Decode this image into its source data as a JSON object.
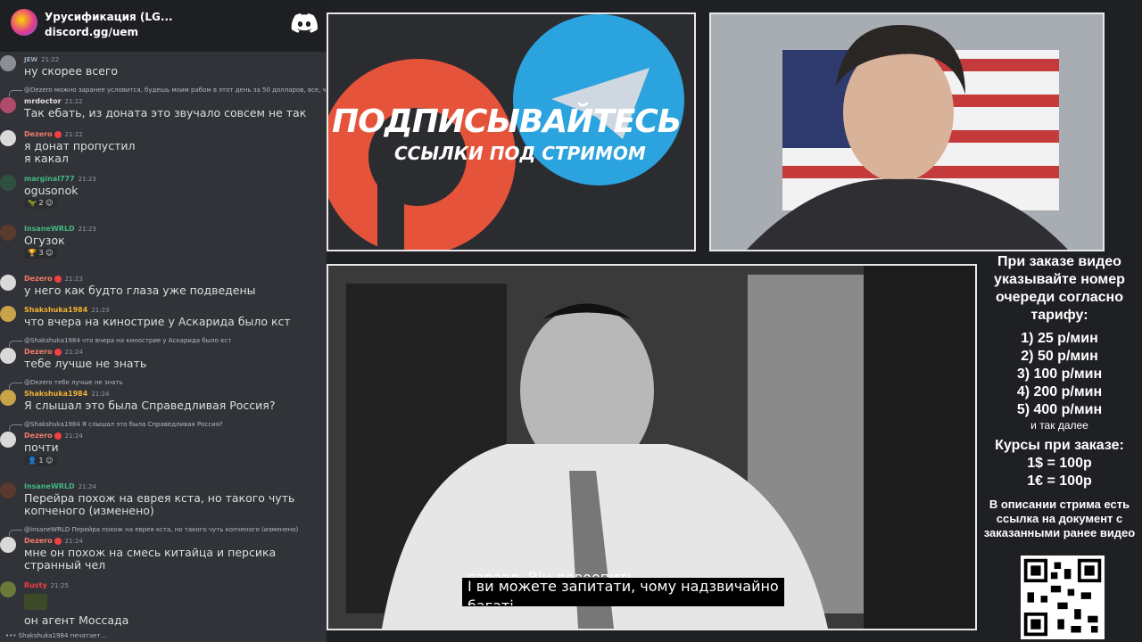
{
  "chat": {
    "server_name": "Урусификация (LG...",
    "server_link": "discord.gg/uem",
    "typing": "Shakshuka1984 печатает...",
    "messages": [
      {
        "name": "",
        "name_color": "#43b581",
        "time": "21:22",
        "tag": "JEW",
        "text": "ну скорее всего"
      },
      {
        "reply": "@Dezero можно заранее условится, будешь моим рабом в этот день за 50 долларов, все, че скажу",
        "name": "mrdoctor",
        "name_color": "#e0e0e0",
        "time": "21:22",
        "text": "Так ебать, из доната это звучало совсем не так"
      },
      {
        "name": "Dezero",
        "name_color": "#f47b67",
        "time": "21:22",
        "text": "я донат пропустил",
        "text2": "я какал"
      },
      {
        "name": "marginal777",
        "name_color": "#43b581",
        "time": "21:23",
        "text": "ogusonok",
        "reaction": "2"
      },
      {
        "name": "InsaneWRLD",
        "name_color": "#43b581",
        "time": "21:23",
        "text": "Огузок",
        "reaction": "3"
      },
      {
        "name": "Dezero",
        "name_color": "#f47b67",
        "time": "21:23",
        "text": "у него как будто глаза уже подведены"
      },
      {
        "name": "Shakshuka1984",
        "name_color": "#f0b232",
        "time": "21:23",
        "text": "что вчера на кинострие у Аскарида было кст"
      },
      {
        "reply": "@Shakshuka1984 что вчера на кинострие у Аскарида было кст",
        "name": "Dezero",
        "name_color": "#f47b67",
        "time": "21:24",
        "text": "тебе лучше не знать"
      },
      {
        "reply": "@Dezero тебе лучше не знать",
        "name": "Shakshuka1984",
        "name_color": "#f0b232",
        "time": "21:24",
        "text": "Я слышал это была Справедливая Россия?"
      },
      {
        "reply": "@Shakshuka1984 Я слышал это была Справедливая Россия?",
        "name": "Dezero",
        "name_color": "#f47b67",
        "time": "21:24",
        "text": "почти",
        "reaction": "1"
      },
      {
        "name": "InsaneWRLD",
        "name_color": "#43b581",
        "time": "21:24",
        "text": "Перейра похож на еврея кста, но такого чуть",
        "text2": "копченого (изменено)"
      },
      {
        "reply": "@InsaneWRLD Перейра похож на еврея кста, но такого чуть копченого (изменено)",
        "name": "Dezero",
        "name_color": "#f47b67",
        "time": "21:24",
        "text": "мне он похож на смесь китайца и персика",
        "text2": "странный чел"
      },
      {
        "name": "Rusty",
        "name_color": "#f23f42",
        "time": "21:25",
        "text": "",
        "text2": "он агент Моссада"
      }
    ]
  },
  "promo": {
    "main": "ПОДПИСЫВАЙТЕСЬ",
    "sub": "ССЫЛКИ ПОД СТРИМОМ"
  },
  "video": {
    "subtitle_line0": "гаразд. Він довоопить.",
    "subtitle_line1": "І ви можете запитати, чому надзвичайно",
    "subtitle_line2": "багаті"
  },
  "sidebar": {
    "header": "При заказе видео указывайте номер очереди согласно тарифу:",
    "tariffs": [
      "1) 25 р/мин",
      "2) 50 р/мин",
      "3) 100 р/мин",
      "4) 200 р/мин",
      "5) 400 р/мин"
    ],
    "tariffs_more": "и так далее",
    "rates_header": "Курсы при заказе:",
    "rates": [
      "1$ = 100р",
      "1€ = 100р"
    ],
    "description": "В описании стрима есть ссылка на документ с заказанными ранее видео"
  },
  "colors": {
    "telegram_blue": "#2aa3df",
    "patreon_red": "#e4533a",
    "discord_bg": "#313338"
  }
}
